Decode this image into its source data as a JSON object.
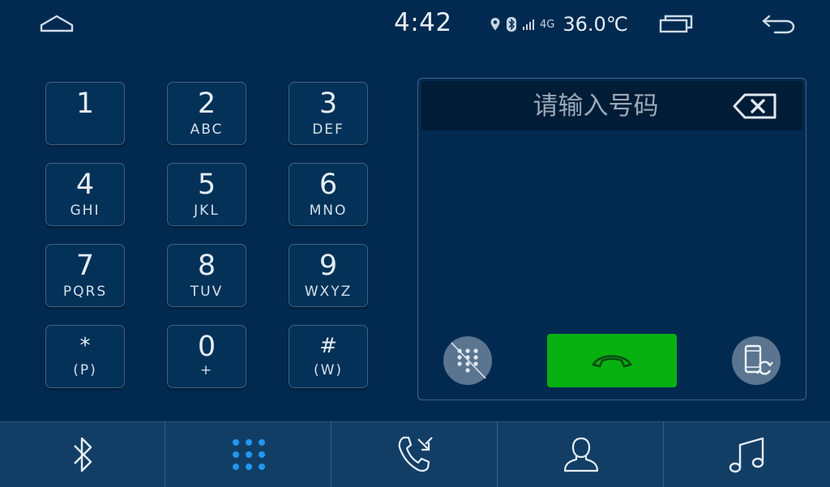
{
  "status_bar": {
    "time": "4:42",
    "network": "4G",
    "temperature": "36.0℃",
    "icons": [
      "home-icon",
      "location-icon",
      "bluetooth-icon",
      "signal-icon",
      "recent-apps-icon",
      "back-icon"
    ]
  },
  "keypad": {
    "keys": [
      {
        "digit": "1",
        "letters": ""
      },
      {
        "digit": "2",
        "letters": "ABC"
      },
      {
        "digit": "3",
        "letters": "DEF"
      },
      {
        "digit": "4",
        "letters": "GHI"
      },
      {
        "digit": "5",
        "letters": "JKL"
      },
      {
        "digit": "6",
        "letters": "MNO"
      },
      {
        "digit": "7",
        "letters": "PQRS"
      },
      {
        "digit": "8",
        "letters": "TUV"
      },
      {
        "digit": "9",
        "letters": "WXYZ"
      },
      {
        "digit": "*",
        "letters": "(P)"
      },
      {
        "digit": "0",
        "letters": "+"
      },
      {
        "digit": "#",
        "letters": "(W)"
      }
    ]
  },
  "dial_panel": {
    "number_value": "",
    "number_placeholder": "请输入号码",
    "icons": [
      "backspace-icon",
      "hide-keypad-icon",
      "handset-icon",
      "switch-to-phone-icon"
    ]
  },
  "bottom_nav": {
    "active": "keypad",
    "items": [
      "bluetooth-icon",
      "keypad-icon",
      "call-log-icon",
      "contacts-icon",
      "music-icon"
    ],
    "icon_color": "#e6eef6",
    "active_color": "#2196f3"
  },
  "colors": {
    "background": "#022a50",
    "call_button": "#07b10f",
    "nav_bar": "#123e66"
  }
}
